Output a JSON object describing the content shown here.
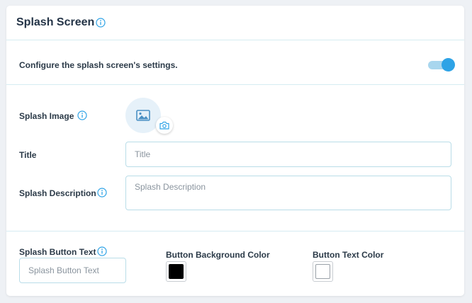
{
  "header": {
    "title": "Splash Screen",
    "info_icon": "info-circle-icon"
  },
  "config": {
    "text": "Configure the splash screen's settings.",
    "enabled": true
  },
  "splash_image": {
    "label": "Splash Image",
    "placeholder_icon": "image-icon",
    "upload_icon": "camera-icon"
  },
  "title_field": {
    "label": "Title",
    "placeholder": "Title",
    "value": ""
  },
  "description_field": {
    "label": "Splash Description",
    "placeholder": "Splash Description",
    "value": ""
  },
  "button_text_field": {
    "label": "Splash Button Text",
    "placeholder": "Splash Button Text",
    "value": ""
  },
  "button_bg_color": {
    "label": "Button Background Color",
    "color": "#000000"
  },
  "button_text_color": {
    "label": "Button Text Color",
    "color": "#ffffff"
  },
  "colors": {
    "accent": "#2ea3e6",
    "toggle_track": "#a8d6ee",
    "border": "#b9dde8"
  }
}
